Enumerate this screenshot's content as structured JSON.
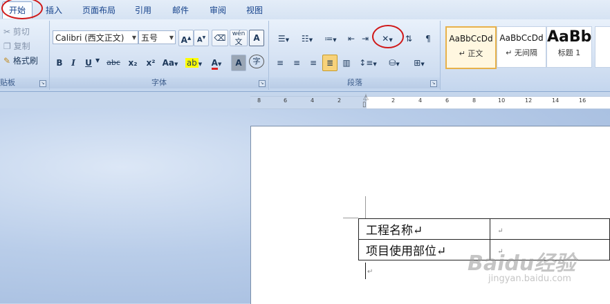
{
  "tabs": [
    "开始",
    "插入",
    "页面布局",
    "引用",
    "邮件",
    "审阅",
    "视图"
  ],
  "clipboard": {
    "cut": "剪切",
    "copy": "复制",
    "format_painter": "格式刷",
    "label": "贴板"
  },
  "font": {
    "name": "Calibri (西文正文)",
    "size": "五号",
    "label": "字体",
    "grow": "A",
    "shrink": "A",
    "bold": "B",
    "italic": "I",
    "underline": "U",
    "strike": "abc",
    "subscript": "x₂",
    "superscript": "x²",
    "change_case": "Aa",
    "color_a": "A",
    "char_shading": "A",
    "enclose": "字",
    "phonetic": "wén",
    "phonetic_char": "文",
    "border_a": "A",
    "clear": "A"
  },
  "paragraph": {
    "label": "段落"
  },
  "styles": [
    {
      "sample": "AaBbCcDd",
      "name": "↵ 正文"
    },
    {
      "sample": "AaBbCcDd",
      "name": "↵ 无间隔"
    },
    {
      "sample": "AaBb",
      "name": "标题 1"
    }
  ],
  "ruler": {
    "left_ticks": [
      "8",
      "6",
      "4",
      "2"
    ],
    "right_ticks": [
      "2",
      "4",
      "6",
      "8",
      "10",
      "12",
      "14",
      "16"
    ]
  },
  "document": {
    "rows": [
      {
        "label": "工程名称↵",
        "value": "↵"
      },
      {
        "label": "项目使用部位↵",
        "value": "↵"
      }
    ],
    "after_mark": "↵"
  },
  "watermark": {
    "brand": "Baidu经验",
    "url": "jingyan.baidu.com"
  }
}
